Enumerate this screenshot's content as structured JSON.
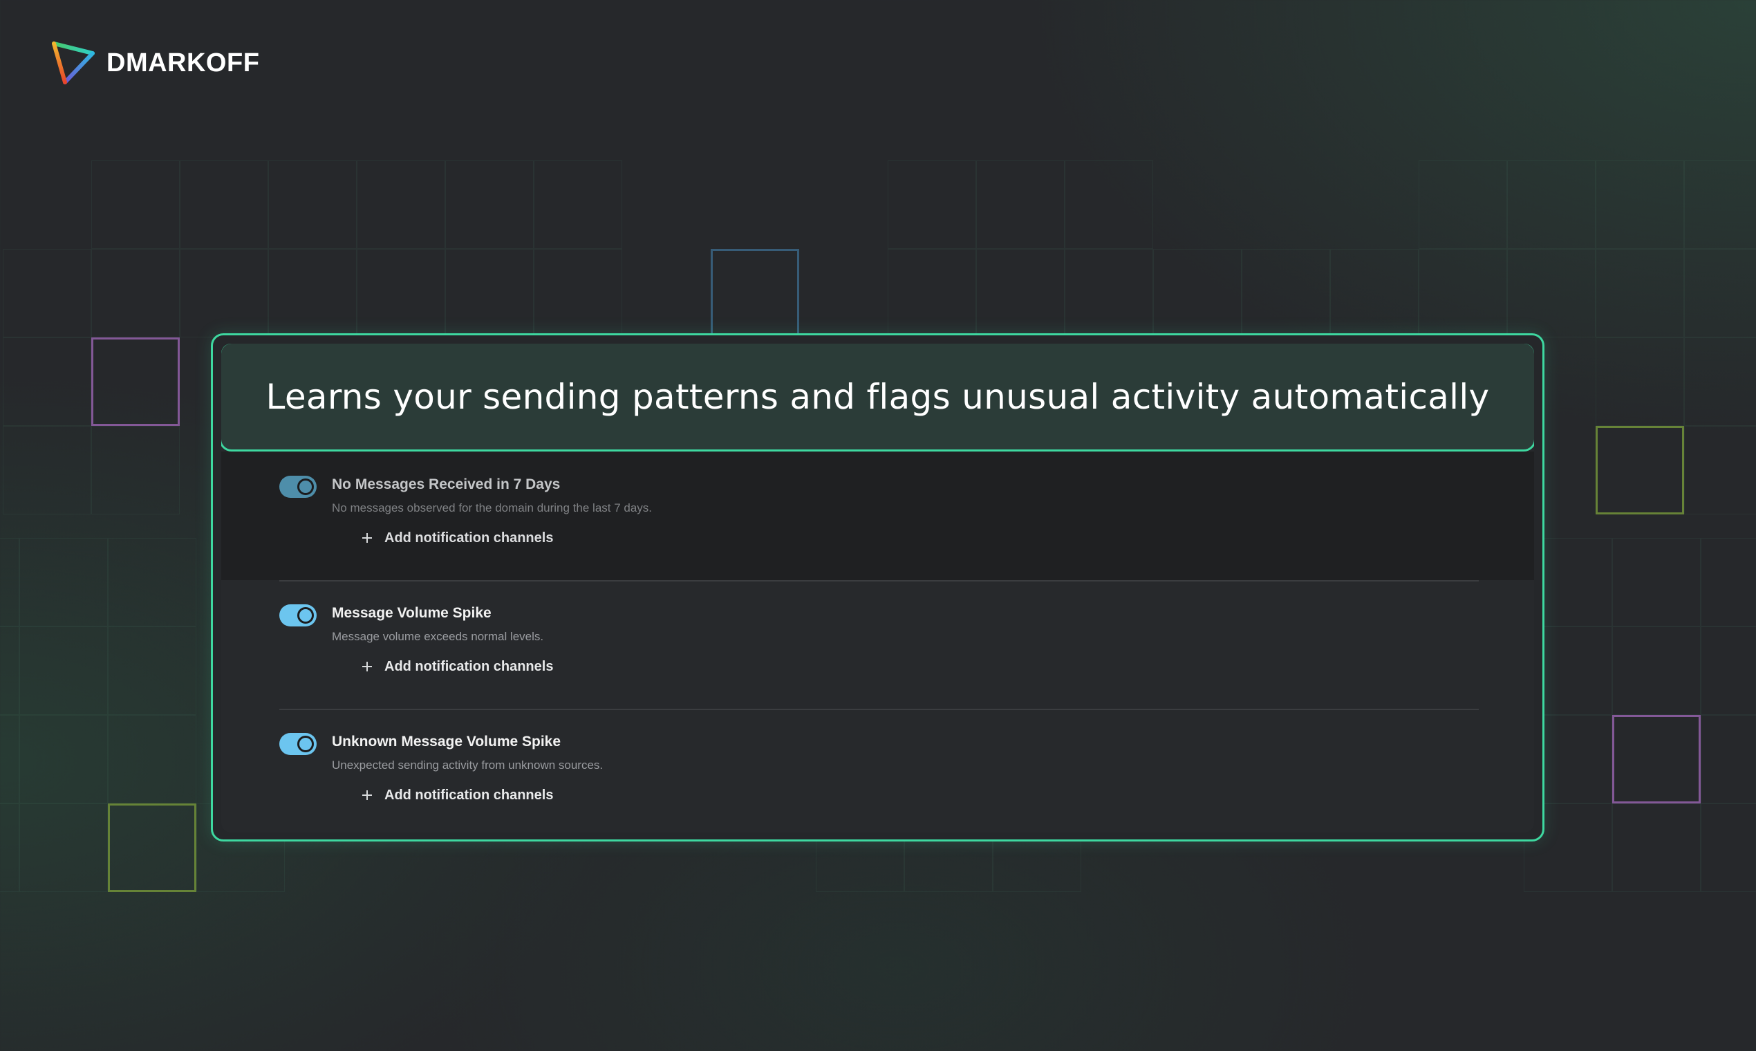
{
  "brand": {
    "name": "DMARKOFF",
    "logo_icon": "triangle-play-logo-icon"
  },
  "banner": {
    "text": "Learns your sending patterns and flags unusual activity automatically"
  },
  "alerts": [
    {
      "title": "No Messages Received in 7 Days",
      "description": "No messages observed for the domain during the last 7 days.",
      "enabled": true,
      "action_label": "Add notification channels"
    },
    {
      "title": "Message Volume Spike",
      "description": "Message volume exceeds normal levels.",
      "enabled": true,
      "action_label": "Add notification channels"
    },
    {
      "title": "Unknown Message Volume Spike",
      "description": "Unexpected sending activity from unknown sources.",
      "enabled": true,
      "action_label": "Add notification channels"
    }
  ],
  "colors": {
    "accent": "#3ed8a0",
    "toggle_on": "#6cc5ef",
    "background": "#26282b"
  }
}
